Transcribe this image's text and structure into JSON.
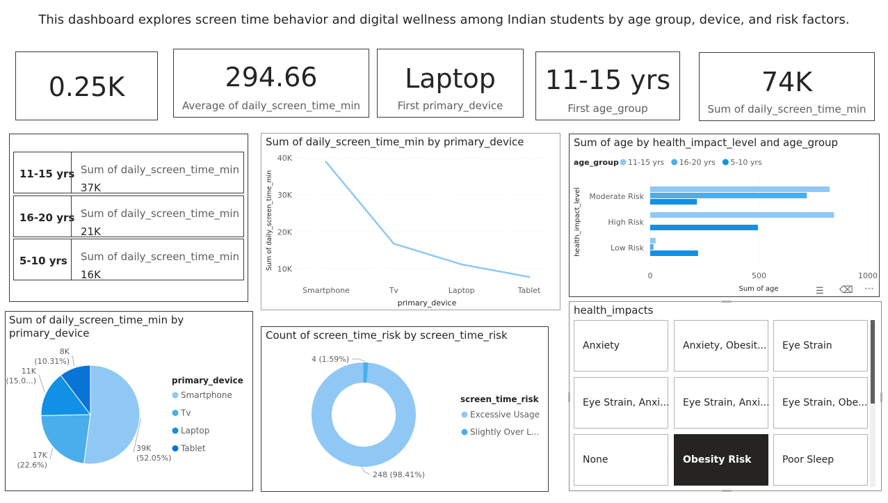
{
  "header": {
    "subtitle": "This dashboard explores screen time behavior and digital wellness among Indian students by age group, device, and risk factors."
  },
  "kpis": [
    {
      "value": "0.25K",
      "label": ""
    },
    {
      "value": "294.66",
      "label": "Average of daily_screen_time_min"
    },
    {
      "value": "Laptop",
      "label": "First primary_device"
    },
    {
      "value": "11-15 yrs",
      "label": "First age_group"
    },
    {
      "value": "74K",
      "label": "Sum of daily_screen_time_min"
    }
  ],
  "multirow": {
    "rows": [
      {
        "category": "11-15 yrs",
        "label": "Sum of daily_screen_time_min",
        "value": "37K"
      },
      {
        "category": "16-20 yrs",
        "label": "Sum of daily_screen_time_min",
        "value": "21K"
      },
      {
        "category": "5-10 yrs",
        "label": "Sum of daily_screen_time_min",
        "value": "16K"
      }
    ]
  },
  "pie_visual": {
    "title_line1": "Sum of daily_screen_time_min by",
    "title_line2": "primary_device"
  },
  "donut_visual": {
    "title": "Count of screen_time_risk by screen_time_risk"
  },
  "line_visual": {
    "title": "Sum of daily_screen_time_min by primary_device"
  },
  "bar_visual": {
    "title": "Sum of age by health_impact_level and age_group"
  },
  "slicer": {
    "title": "health_impacts",
    "items": [
      "Anxiety",
      "Anxiety, Obesit...",
      "Eye Strain",
      "Eye Strain, Anxi...",
      "Eye Strain, Anxi...",
      "Eye Strain, Obe...",
      "None",
      "Obesity Risk",
      "Poor Sleep"
    ],
    "selected": "Obesity Risk"
  },
  "colors": {
    "light_blue": "#8fc8f4",
    "mid_blue": "#4aaeec",
    "blue": "#1191e6",
    "dark_blue": "#0a74d6",
    "selected_tile": "#252423"
  },
  "chart_data": [
    {
      "type": "line",
      "title": "Sum of daily_screen_time_min by primary_device",
      "categories": [
        "Smartphone",
        "Tv",
        "Laptop",
        "Tablet"
      ],
      "values": [
        38900,
        16800,
        11200,
        7800
      ],
      "xlabel": "primary_device",
      "ylabel": "Sum of daily_screen_time_min",
      "yticks": [
        "10K",
        "20K",
        "30K",
        "40K"
      ],
      "ylim": [
        8000,
        40000
      ],
      "grid": true
    },
    {
      "type": "bar",
      "orientation": "horizontal",
      "title": "Sum of age by health_impact_level and age_group",
      "categories": [
        "Moderate Risk",
        "High Risk",
        "Low Risk"
      ],
      "series": [
        {
          "name": "11-15 yrs",
          "values": [
            825,
            845,
            25
          ]
        },
        {
          "name": "16-20 yrs",
          "values": [
            720,
            0,
            15
          ]
        },
        {
          "name": "5-10 yrs",
          "values": [
            215,
            495,
            220
          ]
        }
      ],
      "xlabel": "Sum of age",
      "ylabel": "health_impact_level",
      "xticks": [
        "0",
        "500",
        "1000"
      ],
      "xlim": [
        0,
        1000
      ],
      "legend_title": "age_group",
      "legend": "top"
    },
    {
      "type": "pie",
      "title": "Sum of daily_screen_time_min by primary_device",
      "labels": [
        "Smartphone",
        "Tv",
        "Laptop",
        "Tablet"
      ],
      "values": [
        38.5,
        16.7,
        11.1,
        7.6
      ],
      "data_labels": [
        "39K (52.05%)",
        "17K (22.6%)",
        "11K (15.0...)",
        "8K (10.31%)"
      ],
      "legend_title": "primary_device",
      "legend": "right"
    },
    {
      "type": "pie",
      "style": "donut",
      "title": "Count of screen_time_risk by screen_time_risk",
      "labels": [
        "Excessive Usage",
        "Slightly Over L..."
      ],
      "values": [
        248,
        4
      ],
      "data_labels": [
        "248 (98.41%)",
        "4 (1.59%)"
      ],
      "legend_title": "screen_time_risk",
      "legend": "right"
    }
  ]
}
